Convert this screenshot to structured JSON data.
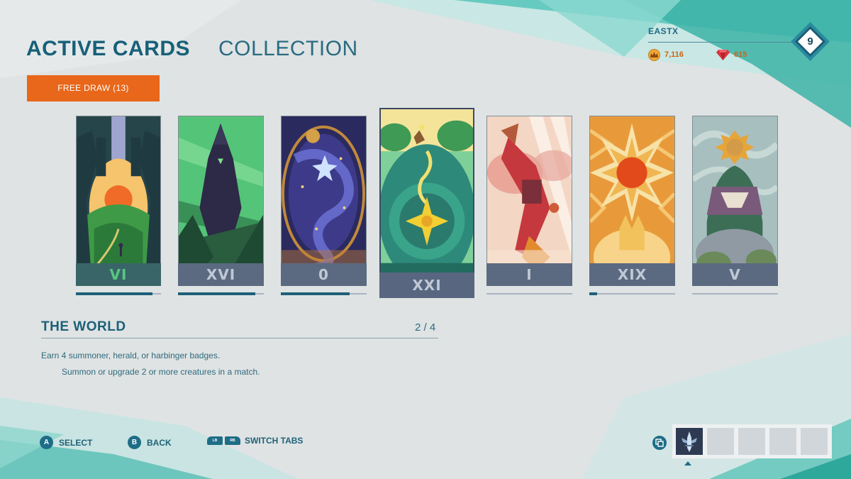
{
  "tabs": {
    "active": "ACTIVE CARDS",
    "inactive": "COLLECTION"
  },
  "free_draw_label": "FREE DRAW (13)",
  "player": {
    "name": "EASTX",
    "level": "9",
    "gold": "7,116",
    "gems": "615"
  },
  "cards": [
    {
      "numeral": "VI",
      "progress": 0.9,
      "selected": false
    },
    {
      "numeral": "XVI",
      "progress": 0.9,
      "selected": false
    },
    {
      "numeral": "0",
      "progress": 0.8,
      "selected": false
    },
    {
      "numeral": "XXI",
      "progress": 0.5,
      "selected": true
    },
    {
      "numeral": "I",
      "progress": 0.0,
      "selected": false
    },
    {
      "numeral": "XIX",
      "progress": 0.09,
      "selected": false
    },
    {
      "numeral": "V",
      "progress": 0.0,
      "selected": false
    }
  ],
  "selected_card": {
    "title": "THE WORLD",
    "count": "2 / 4",
    "description": "Earn 4 summoner, herald, or harbinger badges.",
    "sub_description": "Summon or upgrade 2 or more creatures in a match."
  },
  "prompts": {
    "select": {
      "key": "A",
      "label": "SELECT"
    },
    "back": {
      "key": "B",
      "label": "BACK"
    },
    "switch": {
      "key_left": "LB",
      "key_right": "RB",
      "label": "SWITCH TABS"
    }
  },
  "deck_slots": [
    "filled",
    "empty",
    "empty",
    "empty",
    "empty"
  ],
  "colors": {
    "accent_orange": "#e8671a",
    "title_teal": "#17607a",
    "numeral_slate": "#5b6a80",
    "progress_fill": "#1e5f7a",
    "background": "#dde1e1"
  }
}
